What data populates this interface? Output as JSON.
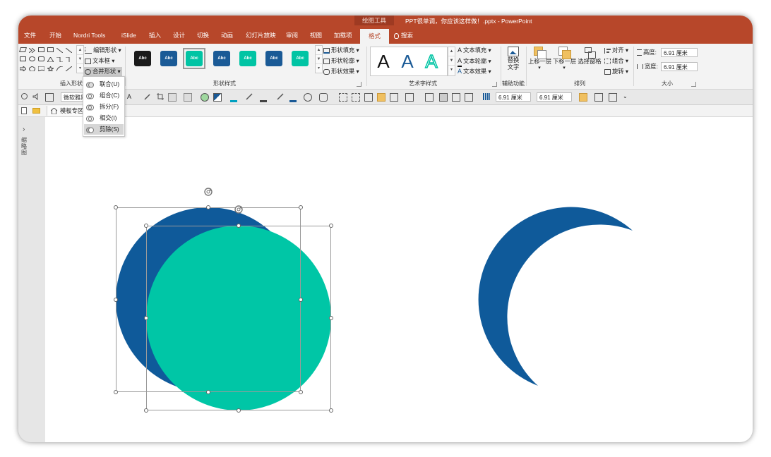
{
  "titlebar": {
    "context_label": "绘图工具",
    "document_title": "PPT很单调，你应该这样做！.pptx - PowerPoint",
    "tabs": [
      "文件",
      "开始",
      "Nordri Tools",
      "iSlide",
      "插入",
      "设计",
      "切换",
      "动画",
      "幻灯片放映",
      "审阅",
      "视图",
      "加载项",
      "格式"
    ],
    "active_tab": "格式",
    "search_label": "搜索"
  },
  "ribbon": {
    "insert_shapes": {
      "label": "插入形状",
      "edit_shape": "编辑形状",
      "text_box": "文本框",
      "merge_shapes": "合并形状"
    },
    "shape_styles": {
      "label": "形状样式",
      "style_text": "Abc",
      "styles": [
        "#1a1a1a",
        "#1a5a96",
        "#00c4a4",
        "#1a5a96",
        "#00c4a4",
        "#1a5a96",
        "#00c4a4"
      ],
      "fill": "形状填充",
      "outline": "形状轮廓",
      "effects": "形状效果"
    },
    "wordart": {
      "label": "艺术字样式",
      "glyph": "A",
      "text_fill": "文本填充",
      "text_outline": "文本轮廓",
      "text_effects": "文本效果"
    },
    "accessibility": {
      "label": "辅助功能",
      "alt_text_line1": "替换",
      "alt_text_line2": "文字"
    },
    "arrange": {
      "label": "排列",
      "bring_forward": "上移一层",
      "send_backward": "下移一层",
      "selection_pane": "选择窗格",
      "align": "对齐",
      "group": "组合",
      "rotate": "旋转"
    },
    "size": {
      "label": "大小",
      "height_label": "高度:",
      "height_value": "6.91 厘米",
      "width_label": "宽度:",
      "width_value": "6.91 厘米"
    }
  },
  "toolbar2": {
    "font_name": "微软雅黑",
    "width_value": "6.91 厘米",
    "height_value": "6.91 厘米"
  },
  "row3": {
    "tab_label": "模板专区"
  },
  "leftpanel": {
    "vertical_text": "缩略图"
  },
  "merge_menu": {
    "items": [
      "联合(U)",
      "组合(C)",
      "拆分(F)",
      "相交(I)",
      "剪除(S)"
    ],
    "highlighted": "剪除(S)"
  },
  "colors": {
    "title_bar": "#b7472a",
    "dark_blue_circle": "#0f5a9a",
    "teal_circle": "#00c6a6",
    "moon": "#0f5a9a"
  }
}
